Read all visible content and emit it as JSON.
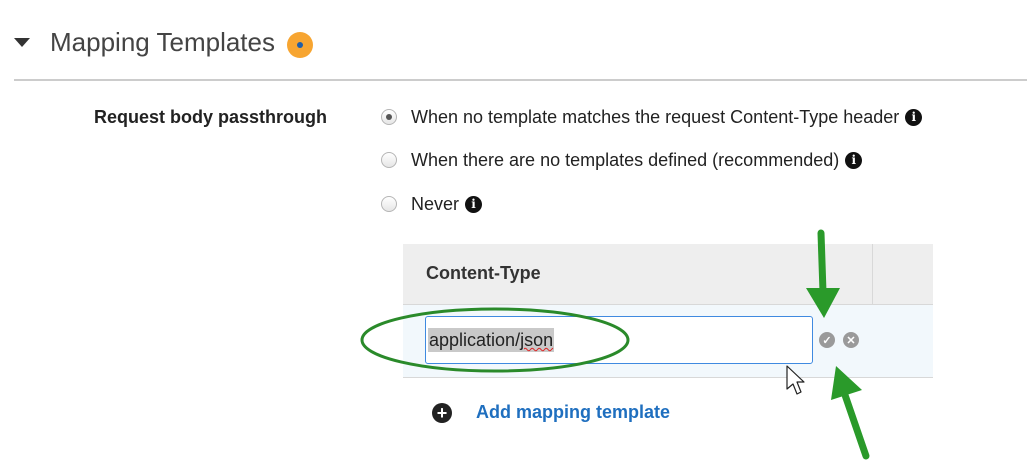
{
  "section": {
    "title": "Mapping Templates",
    "status_color": "#f7a531"
  },
  "passthrough": {
    "label": "Request body passthrough",
    "options": [
      {
        "label": "When no template matches the request Content-Type header",
        "checked": true
      },
      {
        "label": "When there are no templates defined (recommended)",
        "checked": false
      },
      {
        "label": "Never",
        "checked": false
      }
    ]
  },
  "table": {
    "header": "Content-Type",
    "input_value_prefix": "application/",
    "input_value_misspelled": "json"
  },
  "actions": {
    "add_label": "Add mapping template"
  },
  "annotation_colors": {
    "arrow": "#2a9a2a",
    "ellipse": "#2a8a2a"
  }
}
